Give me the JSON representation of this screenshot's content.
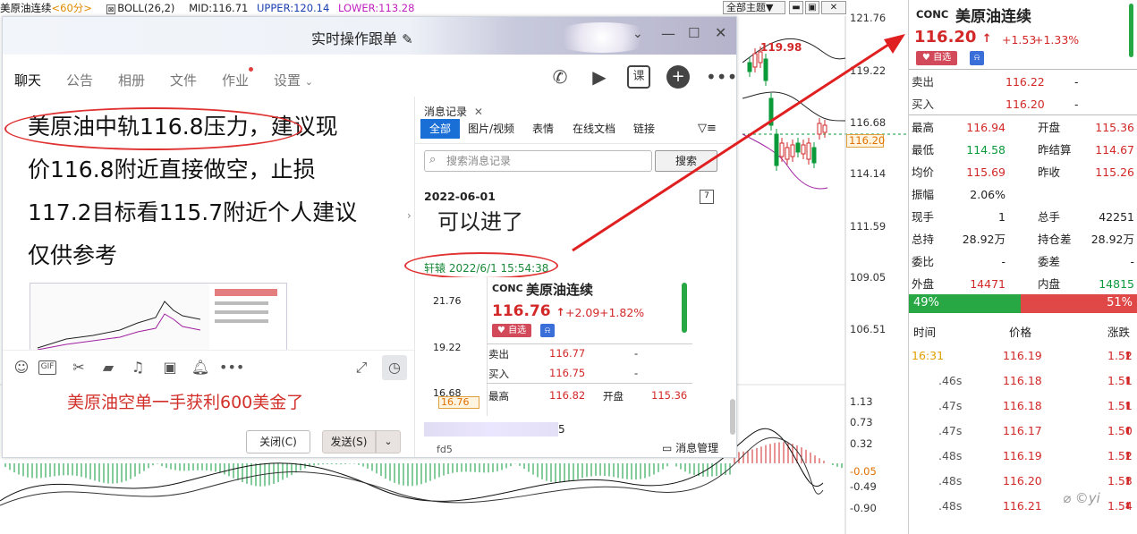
{
  "topbar": {
    "symbol": "美原油连续",
    "period": "<60分>",
    "indicator": "BOLL(26,2)",
    "mid": "MID:116.71",
    "upper": "UPPER:120.14",
    "lower": "LOWER:113.28",
    "theme": "全部主题▼"
  },
  "chart": {
    "axis": [
      "121.76",
      "119.22",
      "116.68",
      "114.14",
      "111.59",
      "109.05",
      "106.51"
    ],
    "current_price_tag": "116.20",
    "peak_label": "119.98",
    "macd_axis": [
      "1.13",
      "0.73",
      "0.32",
      "-0.05",
      "-0.49",
      "-0.90"
    ],
    "colors": {
      "up": "#d22828",
      "down": "#0a9a3a",
      "upper": "#222222",
      "lower": "#a020a0"
    }
  },
  "chat": {
    "title": "实时操作跟单",
    "tabs": [
      "聊天",
      "公告",
      "相册",
      "文件",
      "作业",
      "设置"
    ],
    "message_lines": [
      "美原油中轨116.8压力，建议现",
      "价116.8附近直接做空，止损",
      "117.2目标看115.7附近个人建议",
      "仅供参考"
    ],
    "input_text": "美原油空单一手获利600美金了",
    "close_btn": "关闭(C)",
    "send_btn": "发送(S)"
  },
  "history": {
    "title": "消息记录",
    "tabs": [
      "全部",
      "图片/视频",
      "表情",
      "在线文档",
      "链接"
    ],
    "search_placeholder": "搜索消息记录",
    "search_btn": "搜索",
    "date": "2022-06-01",
    "msg": "可以进了",
    "sender": "轩辕 2022/6/1 15:54:38",
    "footer": "消息管理",
    "blurred_suffix": "5",
    "partial": "fd5"
  },
  "card": {
    "tag": "CONC",
    "name": "美原油连续",
    "price": "116.76",
    "change": "+2.09",
    "pct": "+1.82%",
    "fav": "自选",
    "axis_top": "21.76",
    "axis_mid": "19.22",
    "axis_low": "16.68",
    "price_tag": "16.76",
    "rows": [
      {
        "label": "卖出",
        "value": "116.77",
        "extra": "-"
      },
      {
        "label": "买入",
        "value": "116.75",
        "extra": "-"
      },
      {
        "label": "最高",
        "value": "116.82",
        "extra_label": "开盘",
        "extra": "115.36"
      }
    ]
  },
  "quote": {
    "tag": "CONC",
    "name": "美原油连续",
    "price": "116.20",
    "change": "+1.53",
    "pct": "+1.33%",
    "fav": "自选",
    "sell": {
      "label": "卖出",
      "value": "116.22",
      "extra": "-"
    },
    "buy": {
      "label": "买入",
      "value": "116.20",
      "extra": "-"
    },
    "stats": [
      {
        "l1": "最高",
        "v1": "116.94",
        "l2": "开盘",
        "v2": "115.36"
      },
      {
        "l1": "最低",
        "v1": "114.58",
        "l2": "昨结算",
        "v2": "114.67"
      },
      {
        "l1": "均价",
        "v1": "115.69",
        "l2": "昨收",
        "v2": "115.26"
      },
      {
        "l1": "振幅",
        "v1": "2.06%",
        "l2": "",
        "v2": ""
      },
      {
        "l1": "现手",
        "v1": "1",
        "l2": "总手",
        "v2": "42251"
      },
      {
        "l1": "总持",
        "v1": "28.92万",
        "l2": "持仓差",
        "v2": "28.92万"
      },
      {
        "l1": "委比",
        "v1": "-",
        "l2": "委差",
        "v2": "-"
      },
      {
        "l1": "外盘",
        "v1": "14471",
        "l2": "内盘",
        "v2": "14815"
      }
    ],
    "buy_pct_value": 49,
    "buy_pct": "49%",
    "sell_pct": "51%",
    "tick_headers": [
      "时间",
      "价格",
      "涨跌"
    ],
    "ticks": [
      {
        "t": "16:31",
        "p": "116.19",
        "c": "1.52"
      },
      {
        "t": ".46s",
        "p": "116.18",
        "c": "1.51"
      },
      {
        "t": ".47s",
        "p": "116.18",
        "c": "1.51"
      },
      {
        "t": ".47s",
        "p": "116.17",
        "c": "1.50"
      },
      {
        "t": ".48s",
        "p": "116.19",
        "c": "1.52"
      },
      {
        "t": ".48s",
        "p": "116.20",
        "c": "1.53"
      },
      {
        "t": ".48s",
        "p": "116.21",
        "c": "1.54"
      }
    ]
  }
}
